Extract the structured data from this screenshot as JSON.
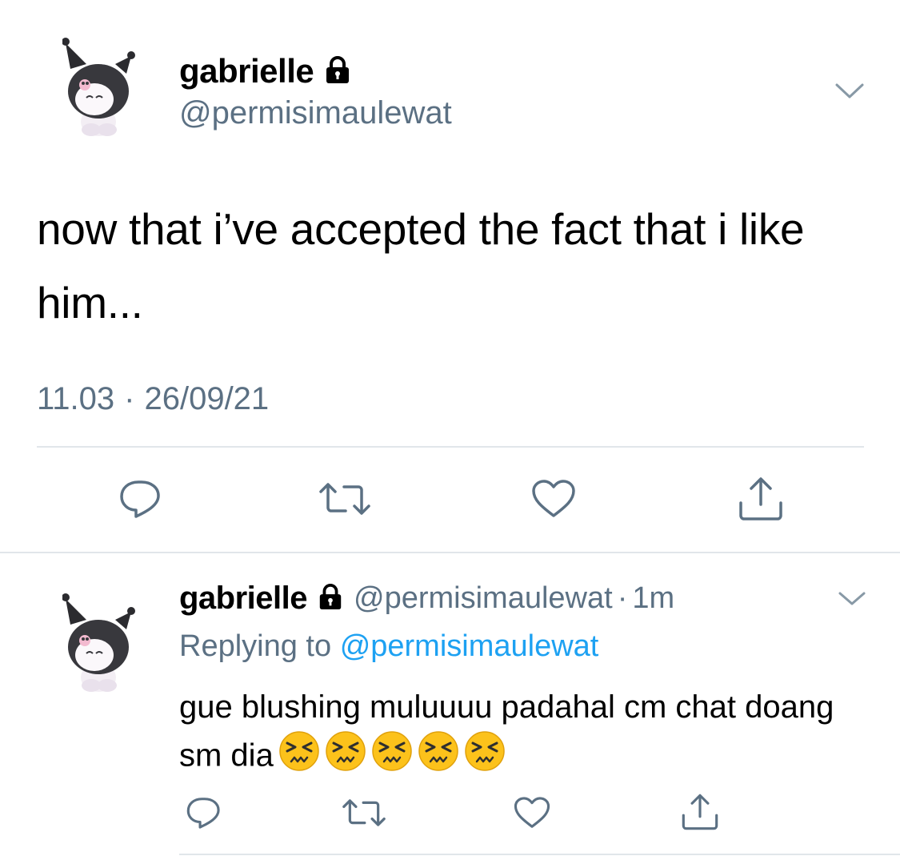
{
  "main_tweet": {
    "display_name": "gabrielle",
    "handle": "@permisimaulewat",
    "text": "now that i’ve accepted the fact that i like him...",
    "time": "11.03",
    "date": "26/09/21",
    "separator": "·"
  },
  "reply_tweet": {
    "display_name": "gabrielle",
    "handle": "@permisimaulewat",
    "separator": "·",
    "time": "1m",
    "replying_prefix": "Replying to",
    "replying_to": "@permisimaulewat",
    "text": "gue blushing muluuuu padahal cm chat doang sm dia",
    "emoji_count": 5
  },
  "colors": {
    "text": "#000000",
    "secondary": "#5b7083",
    "link": "#1da1f2",
    "divider": "#e1e6ea",
    "icon": "#5b7083"
  },
  "icons": {
    "lock": "lock-icon",
    "chevron": "chevron-down-icon",
    "reply": "reply-icon",
    "retweet": "retweet-icon",
    "like": "heart-icon",
    "share": "share-icon",
    "emoji": "persevering-face-emoji"
  }
}
